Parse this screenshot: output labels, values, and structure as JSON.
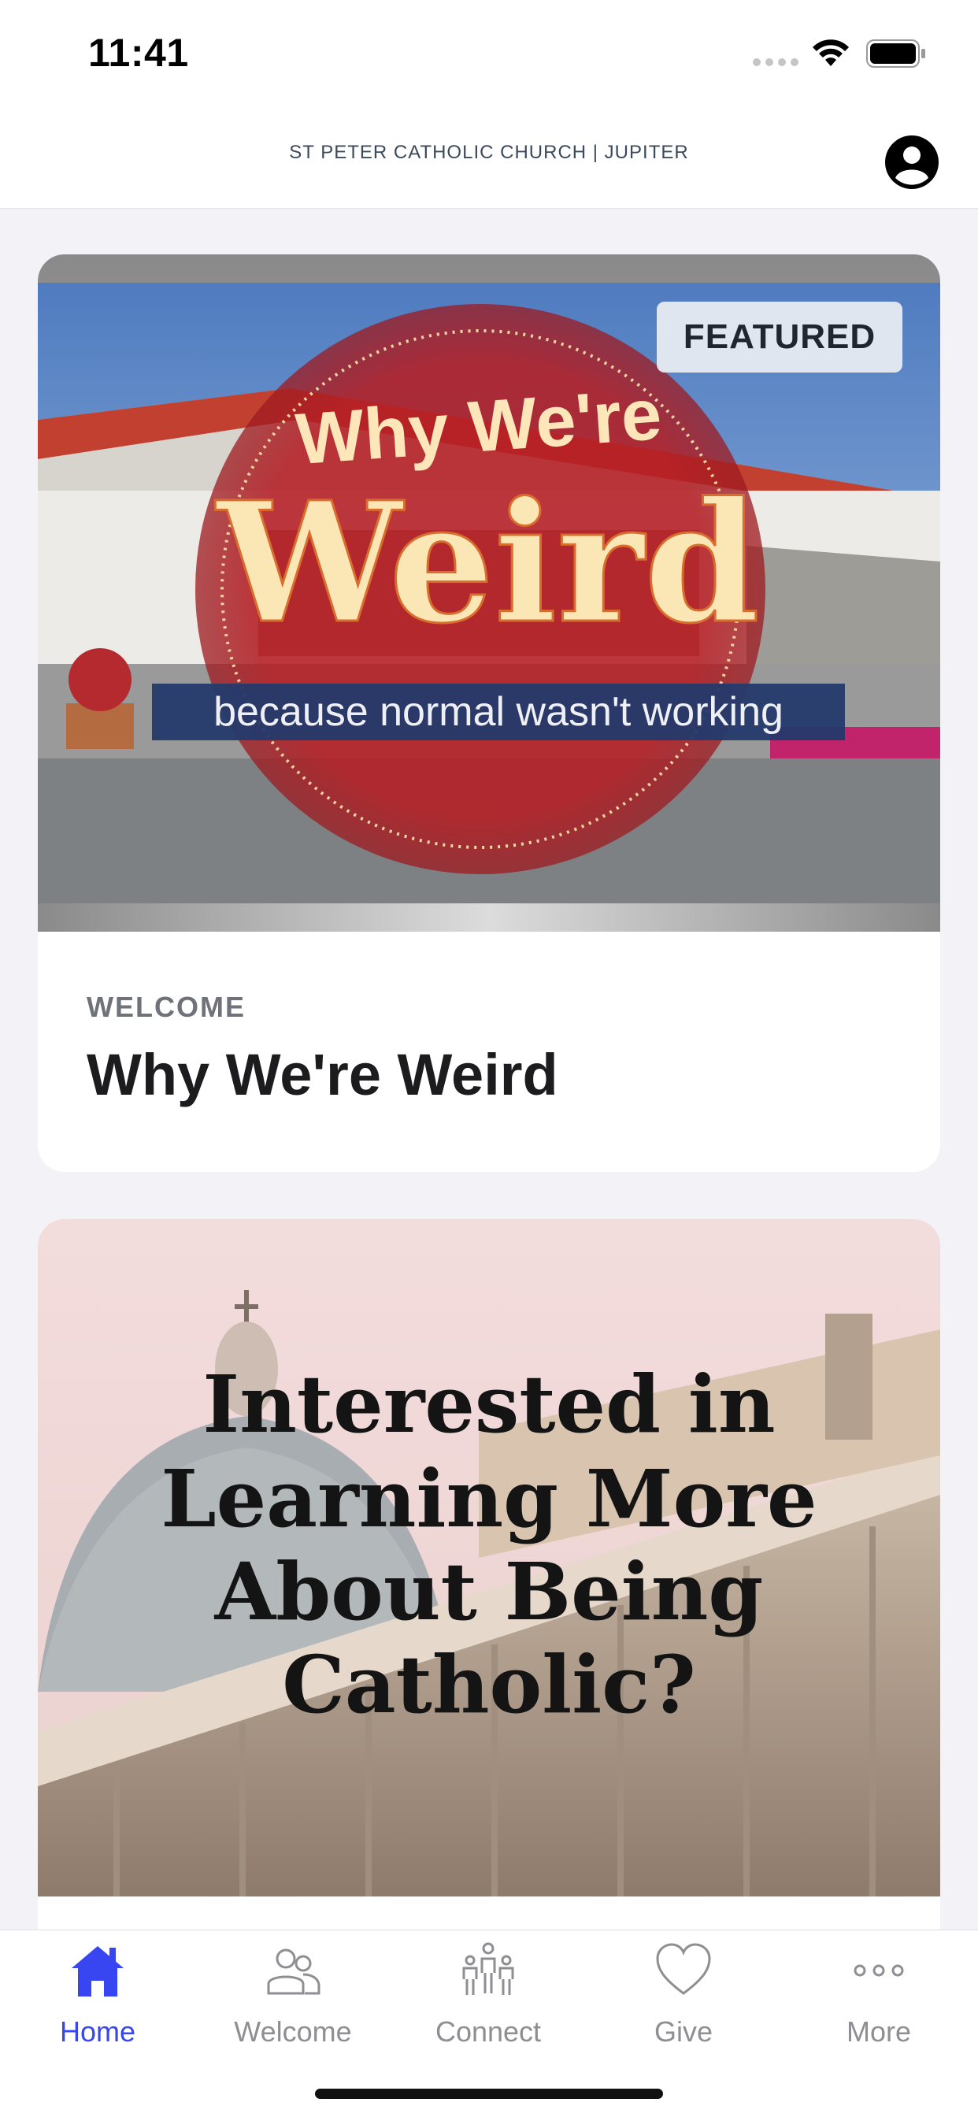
{
  "status_bar": {
    "time": "11:41"
  },
  "header": {
    "title": "ST PETER CATHOLIC CHURCH | JUPITER",
    "profile_icon": "person-circle-icon"
  },
  "feed": {
    "cards": [
      {
        "badge": "FEATURED",
        "image_text": {
          "top": "Why We're",
          "main": "Weird",
          "banner": "because normal wasn't working"
        },
        "category": "WELCOME",
        "title": "Why We're Weird"
      },
      {
        "image_text": {
          "lines": [
            "Interested in",
            "Learning More",
            "About Being",
            "Catholic?"
          ]
        }
      }
    ]
  },
  "tab_bar": {
    "items": [
      {
        "label": "Home",
        "icon": "house-icon",
        "active": true
      },
      {
        "label": "Welcome",
        "icon": "people-icon",
        "active": false
      },
      {
        "label": "Connect",
        "icon": "group-icon",
        "active": false
      },
      {
        "label": "Give",
        "icon": "heart-icon",
        "active": false
      },
      {
        "label": "More",
        "icon": "ellipsis-icon",
        "active": false
      }
    ]
  },
  "colors": {
    "accent": "#3846f2",
    "inactive": "#8e8e93",
    "badge_bg": "#ebeef3",
    "circle_red": "#b41e24"
  }
}
